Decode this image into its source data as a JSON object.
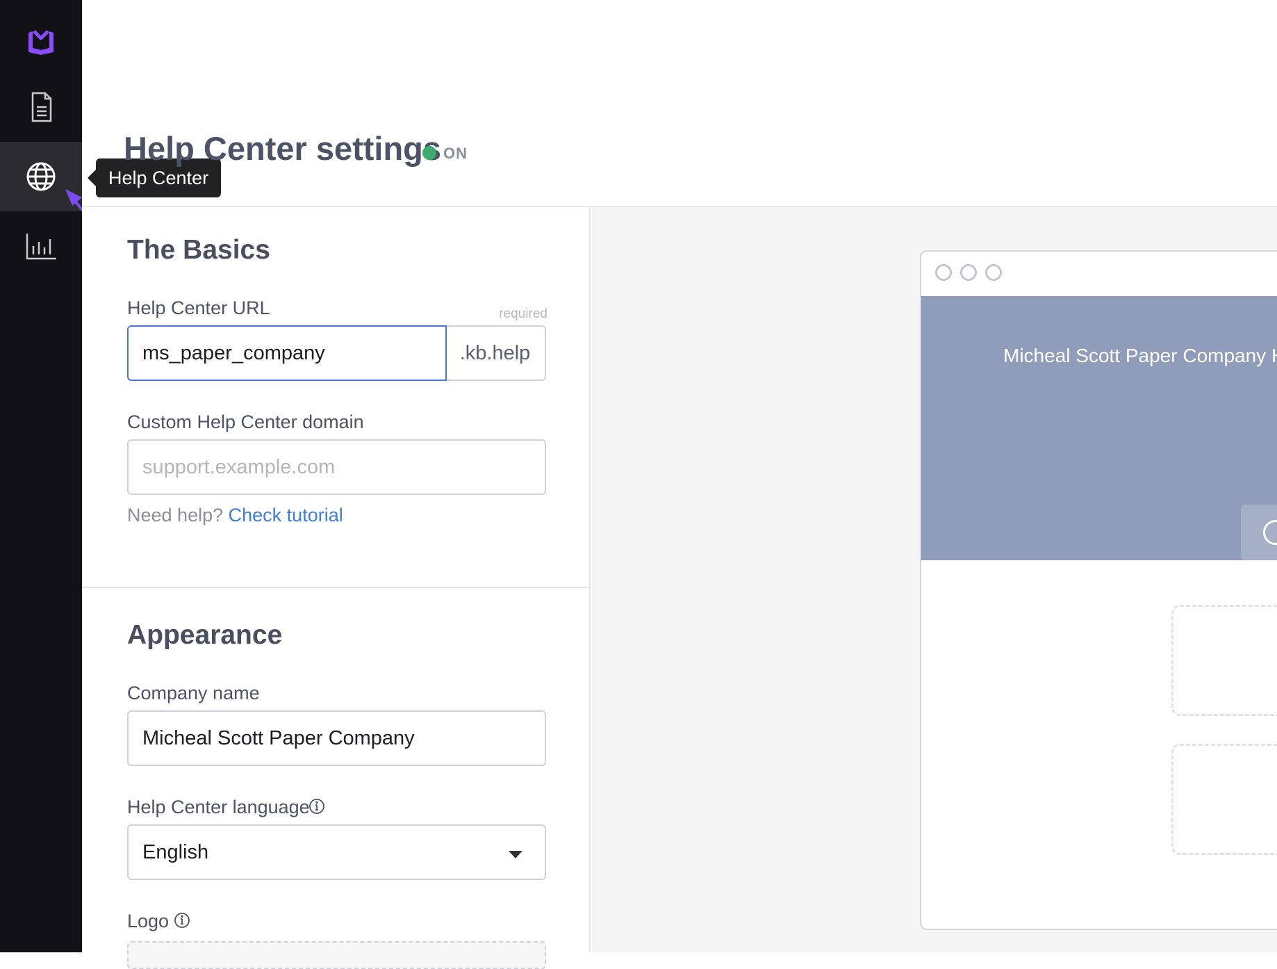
{
  "sidebar": {
    "logo_icon": "book-logo-icon",
    "accent_color": "#8a4dfc",
    "items": [
      {
        "icon": "document-icon",
        "label": "Articles"
      },
      {
        "icon": "globe-icon",
        "label": "Help Center"
      },
      {
        "icon": "bar-chart-icon",
        "label": "Analytics"
      }
    ],
    "tooltip": "Help Center"
  },
  "header": {
    "title": "Help Center settings",
    "status": "ON",
    "status_color": "#3eaa6b"
  },
  "basics": {
    "title": "The Basics",
    "url_label": "Help Center URL",
    "url_required": "required",
    "url_value": "ms_paper_company",
    "url_suffix": ".kb.help",
    "domain_label": "Custom Help Center domain",
    "domain_placeholder": "support.example.com",
    "help_prefix": "Need help?",
    "help_link": "Check tutorial"
  },
  "appearance": {
    "title": "Appearance",
    "company_label": "Company name",
    "company_value": "Micheal Scott Paper Company",
    "language_label": "Help Center language",
    "language_value": "English",
    "logo_label": "Logo"
  },
  "preview": {
    "hero_title": "Micheal Scott Paper Company H",
    "hero_color": "#8f9cba"
  }
}
